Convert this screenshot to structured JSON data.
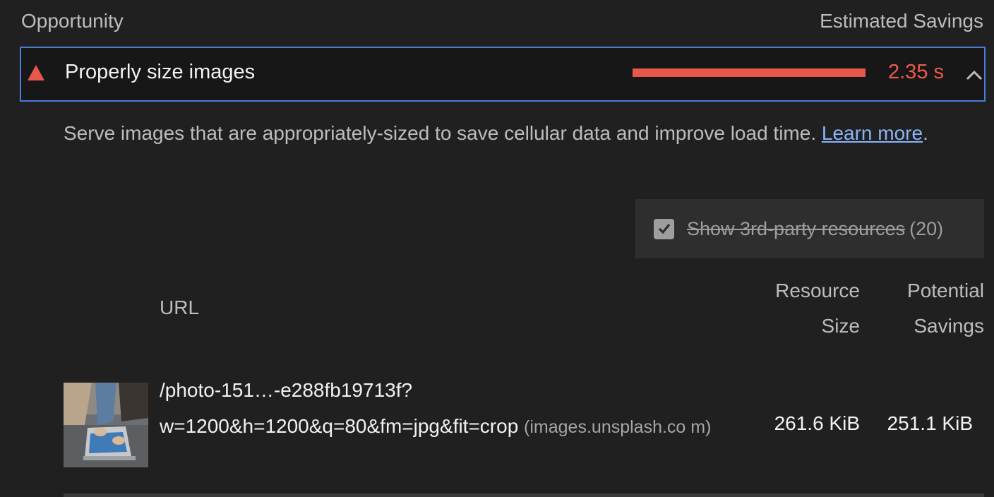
{
  "header": {
    "left": "Opportunity",
    "right": "Estimated Savings"
  },
  "audit": {
    "title": "Properly size images",
    "savings": "2.35 s",
    "savings_fraction": 1.0,
    "colors": {
      "fail": "#e8574b",
      "focus_border": "#4b7bd8"
    },
    "icons": {
      "status": "warning-triangle-icon",
      "toggle": "chevron-up-icon"
    }
  },
  "description": {
    "text": "Serve images that are appropriately-sized to save cellular data and improve load time. ",
    "link": "Learn more",
    "trailing": "."
  },
  "third_party_toggle": {
    "label": "Show 3rd-party resources",
    "count": "(20)",
    "checked": true
  },
  "table": {
    "headers": {
      "url": "URL",
      "size_line1": "Resource",
      "size_line2": "Size",
      "savings_line1": "Potential",
      "savings_line2": "Savings"
    },
    "rows": [
      {
        "url_line1": "/photo-151…-e288fb19713f?",
        "url_line2": "w=1200&h=1200&q=80&fm=jpg&fit=crop",
        "host": "(images.unsplash.co m)",
        "resource_size": "261.6 KiB",
        "potential_savings": "251.1 KiB"
      }
    ]
  }
}
